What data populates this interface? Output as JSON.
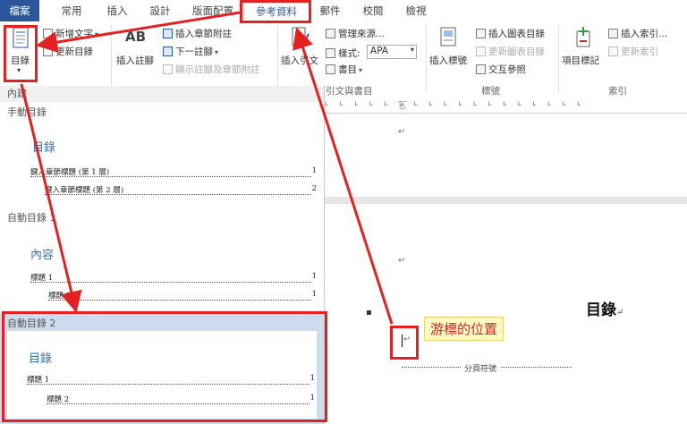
{
  "tabs": {
    "file": "檔案",
    "home": "常用",
    "insert": "插入",
    "design": "設計",
    "layout": "版面配置",
    "references": "參考資料",
    "mailings": "郵件",
    "review": "校閱",
    "view": "檢視"
  },
  "ribbon": {
    "toc_button": "目錄",
    "add_text": "新增文字",
    "update_toc": "更新目錄",
    "insert_footnote": "插入註腳",
    "footnote_ab": "AB",
    "insert_endnote": "插入章節附註",
    "next_footnote": "下一註腳",
    "show_notes": "顯示註腳及章節附註",
    "insert_citation": "插入引文",
    "manage_sources": "管理來源...",
    "style_label": "樣式:",
    "style_value": "APA",
    "bibliography": "書目",
    "group_citations": "引文與書目",
    "insert_caption": "插入標號",
    "insert_table_of_figures": "插入圖表目錄",
    "update_table": "更新圖表目錄",
    "cross_reference": "交互參照",
    "group_captions": "標號",
    "mark_entry": "項目標記",
    "insert_index": "插入索引...",
    "update_index": "更新索引",
    "group_index": "索引"
  },
  "toc_gallery": {
    "builtin": "內建",
    "manual_label": "手動目錄",
    "manual_title": "目錄",
    "manual_line1": "鍵入章節標題 (第 1 層)",
    "manual_line1_page": "1",
    "manual_line2": "鍵入章節標題 (第 2 層)",
    "manual_line2_page": "2",
    "auto1_label": "自動目錄 1",
    "auto1_title": "內容",
    "auto1_line1": "標題 1",
    "auto1_line1_page": "1",
    "auto1_line2": "標題 2",
    "auto1_line2_page": "1",
    "auto2_label": "自動目錄 2",
    "auto2_title": "目錄",
    "auto2_line1": "標題 1",
    "auto2_line1_page": "1",
    "auto2_line2": "標題 2",
    "auto2_line2_page": "1"
  },
  "document": {
    "heading": "目錄",
    "cursor_callout": "游標的位置",
    "page_break": "分頁符號",
    "pilcrow": "↵"
  },
  "colors": {
    "file_tab": "#2b579a",
    "highlight": "#e52020",
    "toc_title": "#2e74b5",
    "callout_bg": "#fff9c4"
  }
}
